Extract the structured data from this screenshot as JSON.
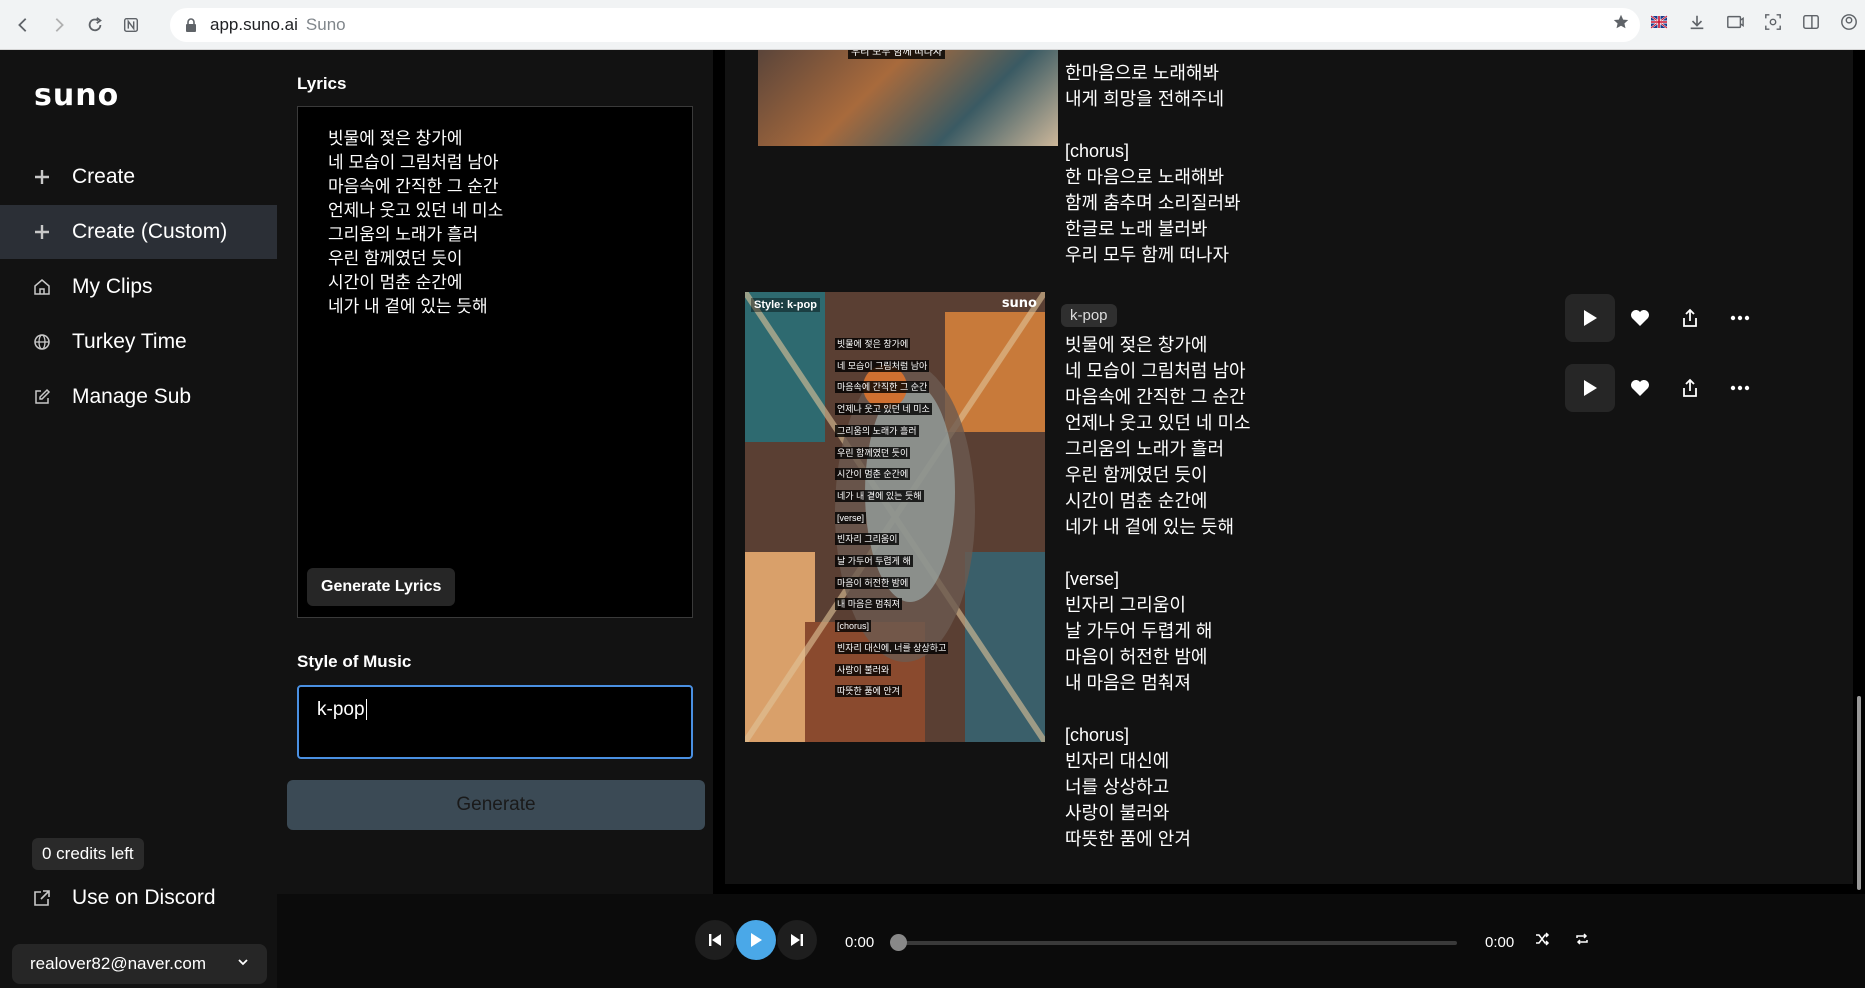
{
  "browser": {
    "url_host": "app.suno.ai",
    "page_title": "Suno"
  },
  "sidebar": {
    "logo": "suno",
    "items": [
      {
        "label": "Create",
        "icon": "plus-icon"
      },
      {
        "label": "Create (Custom)",
        "icon": "plus-icon"
      },
      {
        "label": "My Clips",
        "icon": "home-icon"
      },
      {
        "label": "Turkey Time",
        "icon": "globe-icon"
      },
      {
        "label": "Manage Sub",
        "icon": "edit-icon"
      }
    ],
    "credits": "0 credits left",
    "discord": "Use on Discord",
    "account": "realover82@naver.com"
  },
  "form": {
    "lyrics_label": "Lyrics",
    "lyrics_lines": [
      "빗물에 젖은 창가에",
      "네 모습이 그림처럼 남아",
      "마음속에 간직한 그 순간",
      "언제나 웃고 있던 네 미소",
      "그리움의 노래가 흘러",
      "우린 함께였던 듯이",
      "시간이 멈춘 순간에",
      "네가 내 곁에 있는 듯해"
    ],
    "generate_lyrics": "Generate Lyrics",
    "style_label": "Style of Music",
    "style_value": "k-pop",
    "generate": "Generate"
  },
  "feed": {
    "top_card": {
      "thumb_caption": "우리 모두 함께 떠나자",
      "lyrics": "한마음으로 노래해봐\n내게 희망을 전해주네\n\n[chorus]\n한 마음으로 노래해봐\n함께 춤추며 소리질러봐\n한글로 노래 불러봐\n우리 모두 함께 떠나자"
    },
    "main_card": {
      "tag": "k-pop",
      "thumb_style": "Style: k-pop",
      "thumb_logo": "suno",
      "thumb_lines": [
        "빗물에 젖은 창가에",
        "네 모습이 그림처럼 남아",
        "마음속에 간직한 그 순간",
        "언제나 웃고 있던 네 미소",
        "그리움의 노래가 흘러",
        "우린 함께였던 듯이",
        "시간이 멈춘 순간에",
        "네가 내 곁에 있는 듯해",
        "[verse]",
        "빈자리 그리움이",
        "날 가두어 두렵게 해",
        "마음이 허전한 밤에",
        "내 마음은 멈춰져",
        "[chorus]",
        "빈자리 대신에, 너를 상상하고",
        "사랑이 불러와",
        "따뜻한 품에 안겨"
      ],
      "lyrics": "빗물에 젖은 창가에\n네 모습이 그림처럼 남아\n마음속에 간직한 그 순간\n언제나 웃고 있던 네 미소\n그리움의 노래가 흘러\n우린 함께였던 듯이\n시간이 멈춘 순간에\n네가 내 곁에 있는 듯해\n\n[verse]\n빈자리 그리움이\n날 가두어 두렵게 해\n마음이 허전한 밤에\n내 마음은 멈춰져\n\n[chorus]\n빈자리 대신에\n너를 상상하고\n사랑이 불러와\n따뜻한 품에 안겨"
    }
  },
  "player": {
    "time_current": "0:00",
    "time_total": "0:00",
    "progress": 0
  },
  "colors": {
    "sidebar_bg": "#121212",
    "active_nav": "#2b2f36",
    "input_focus": "#4a90e2",
    "generate_btn": "#3b4a55",
    "play_accent": "#4aa8e8"
  }
}
